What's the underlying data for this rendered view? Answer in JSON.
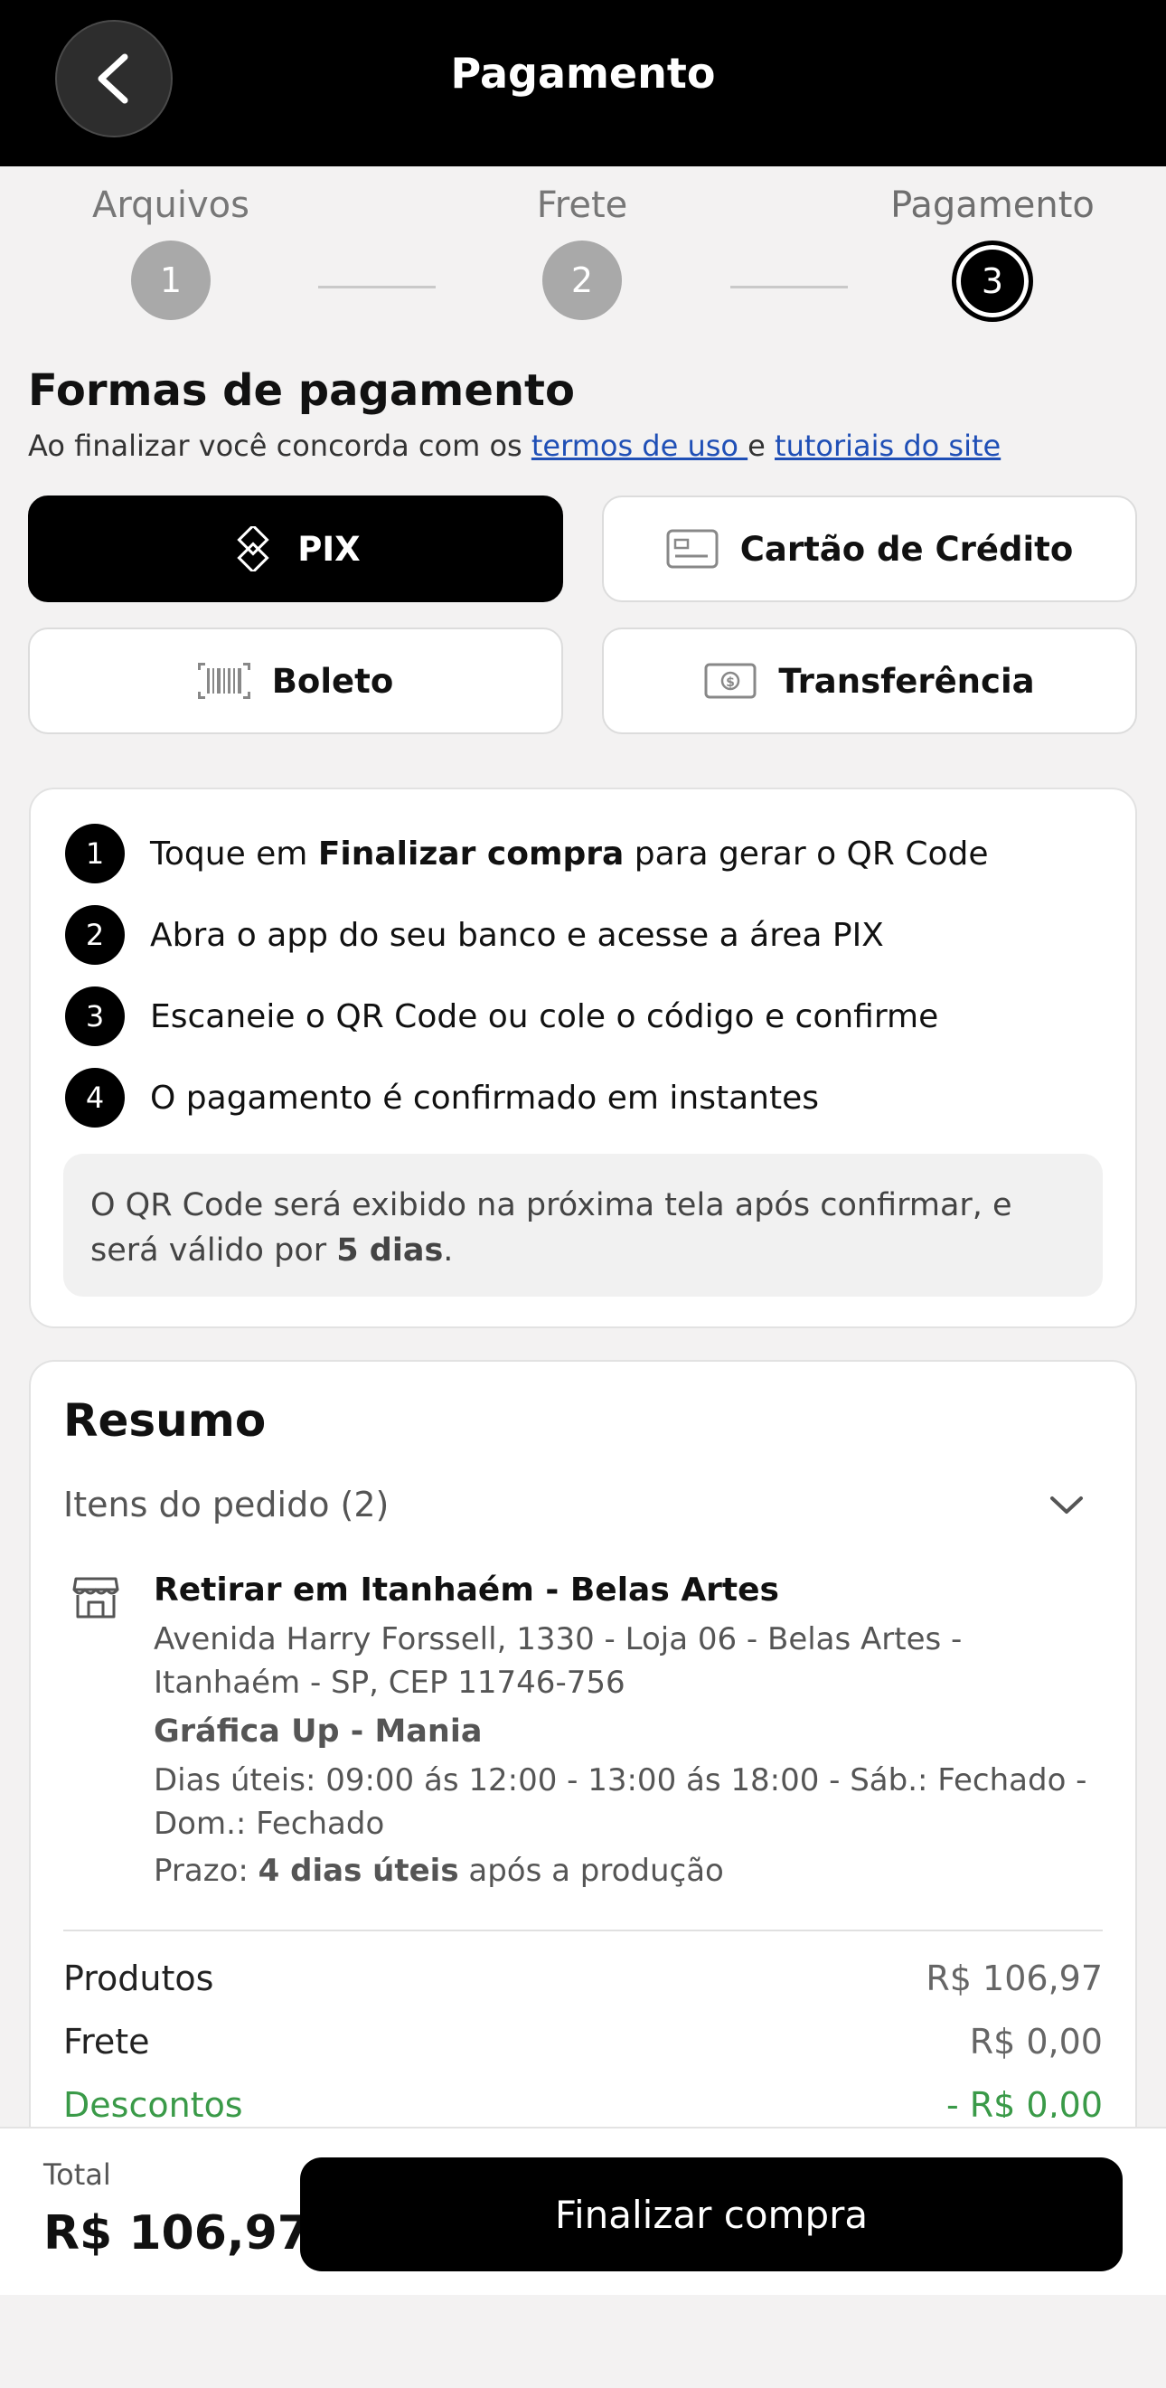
{
  "header": {
    "title": "Pagamento"
  },
  "stepper": {
    "steps": [
      {
        "label": "Arquivos",
        "number": "1"
      },
      {
        "label": "Frete",
        "number": "2"
      },
      {
        "label": "Pagamento",
        "number": "3"
      }
    ]
  },
  "payment": {
    "title": "Formas de pagamento",
    "terms_prefix": "Ao finalizar você concorda com os ",
    "terms_link": "termos de uso ",
    "terms_mid": "e ",
    "tutorials_link": "tutoriais do site",
    "methods": [
      {
        "label": "PIX",
        "icon": "pix-icon",
        "selected": true
      },
      {
        "label": "Cartão de Crédito",
        "icon": "credit-card-icon",
        "selected": false
      },
      {
        "label": "Boleto",
        "icon": "barcode-icon",
        "selected": false
      },
      {
        "label": "Transferência",
        "icon": "cash-transfer-icon",
        "selected": false
      }
    ]
  },
  "pix": {
    "steps": [
      {
        "n": "1",
        "before": "Toque em ",
        "bold": "Finalizar compra",
        "after": " para gerar o QR Code"
      },
      {
        "n": "2",
        "before": "Abra o app do seu banco e acesse a área PIX",
        "bold": "",
        "after": ""
      },
      {
        "n": "3",
        "before": "Escaneie o QR Code ou cole o código e confirme",
        "bold": "",
        "after": ""
      },
      {
        "n": "4",
        "before": "O pagamento é confirmado em instantes",
        "bold": "",
        "after": ""
      }
    ],
    "note_before": "O QR Code será exibido na próxima tela após confirmar, e será válido por ",
    "note_bold": "5 dias",
    "note_after": "."
  },
  "summary": {
    "title": "Resumo",
    "items_label": "Itens do pedido (2)",
    "pickup_title": "Retirar em Itanhaém - Belas Artes",
    "pickup_address": "Avenida Harry Forssell, 1330 - Loja 06 - Belas Artes - Itanhaém - SP, CEP 11746-756",
    "store_name": "Gráfica Up - Mania",
    "hours": "Dias úteis:  09:00 ás 12:00 - 13:00 ás 18:00  - Sáb.: Fechado - Dom.: Fechado",
    "deadline_prefix": "Prazo: ",
    "deadline_bold": "4 dias úteis",
    "deadline_suffix": " após a produção",
    "rows": [
      {
        "label": "Produtos",
        "value": "R$ 106,97"
      },
      {
        "label": "Frete",
        "value": "R$ 0,00"
      },
      {
        "label": "Descontos",
        "value": "- R$ 0,00"
      }
    ]
  },
  "footer": {
    "total_label": "Total",
    "total_value": "R$ 106,97",
    "finish_label": "Finalizar compra"
  },
  "colors": {
    "accent": "#000000",
    "link": "#1f4fb6",
    "discount": "#3a9a48"
  }
}
